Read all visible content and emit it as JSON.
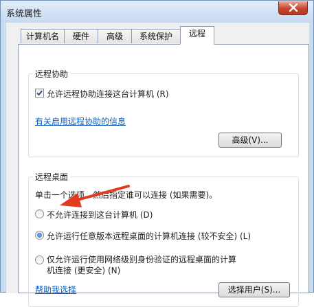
{
  "window": {
    "title": "系统属性"
  },
  "tabs": [
    {
      "label": "计算机名"
    },
    {
      "label": "硬件"
    },
    {
      "label": "高级"
    },
    {
      "label": "系统保护"
    },
    {
      "label": "远程"
    }
  ],
  "remote_assistance": {
    "group_title": "远程协助",
    "allow_checkbox_label": "允许远程协助连接这台计算机 (R)",
    "allow_checked": true,
    "info_link": "有关启用远程协助的信息",
    "advanced_button": "高级(V)..."
  },
  "remote_desktop": {
    "group_title": "远程桌面",
    "instruction": "单击一个选项，然后指定谁可以连接 (如果需要)。",
    "options": [
      {
        "label": "不允许连接到这台计算机 (D)",
        "checked": false
      },
      {
        "label": "允许运行任意版本远程桌面的计算机连接 (较不安全) (L)",
        "checked": true
      },
      {
        "label_line1": "仅允许运行使用网络级别身份验证的远程桌面的计算",
        "label_line2": "机连接 (更安全) (N)",
        "checked": false
      }
    ],
    "help_link": "帮助我选择",
    "select_users_button": "选择用户(S)..."
  },
  "colors": {
    "annotation_arrow": "#e23a1e",
    "link": "#0b5ec1"
  }
}
